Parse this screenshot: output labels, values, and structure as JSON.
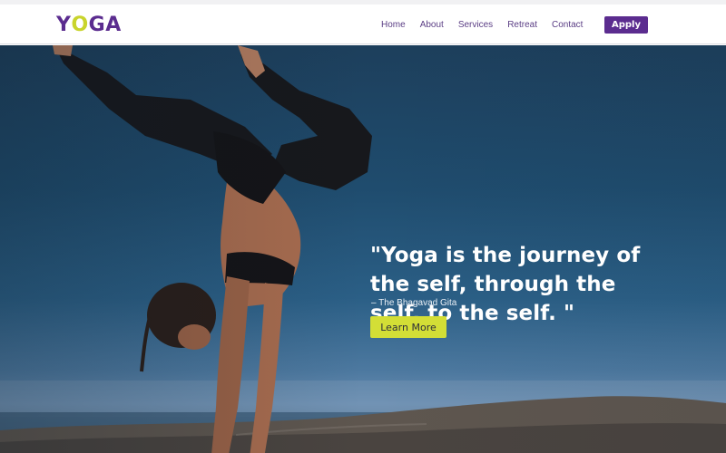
{
  "header": {
    "logo": {
      "part1": "Y",
      "part2": "O",
      "part3": "GA"
    },
    "nav": [
      "Home",
      "About",
      "Services",
      "Retreat",
      "Contact"
    ],
    "apply_label": "Apply"
  },
  "hero": {
    "quote": "\"Yoga is the journey of the self, through the self, to the self. \"",
    "attribution": "– The Bhagavad Gita",
    "cta_label": "Learn More",
    "image_subject": "woman-handstand-yoga-pose-on-rocks"
  },
  "colors": {
    "brand_purple": "#5b2c8f",
    "accent_lime": "#d3de36",
    "sky_dark": "#1d3f5c",
    "sky_light": "#6b8fb3",
    "text_light": "#ffffff"
  }
}
